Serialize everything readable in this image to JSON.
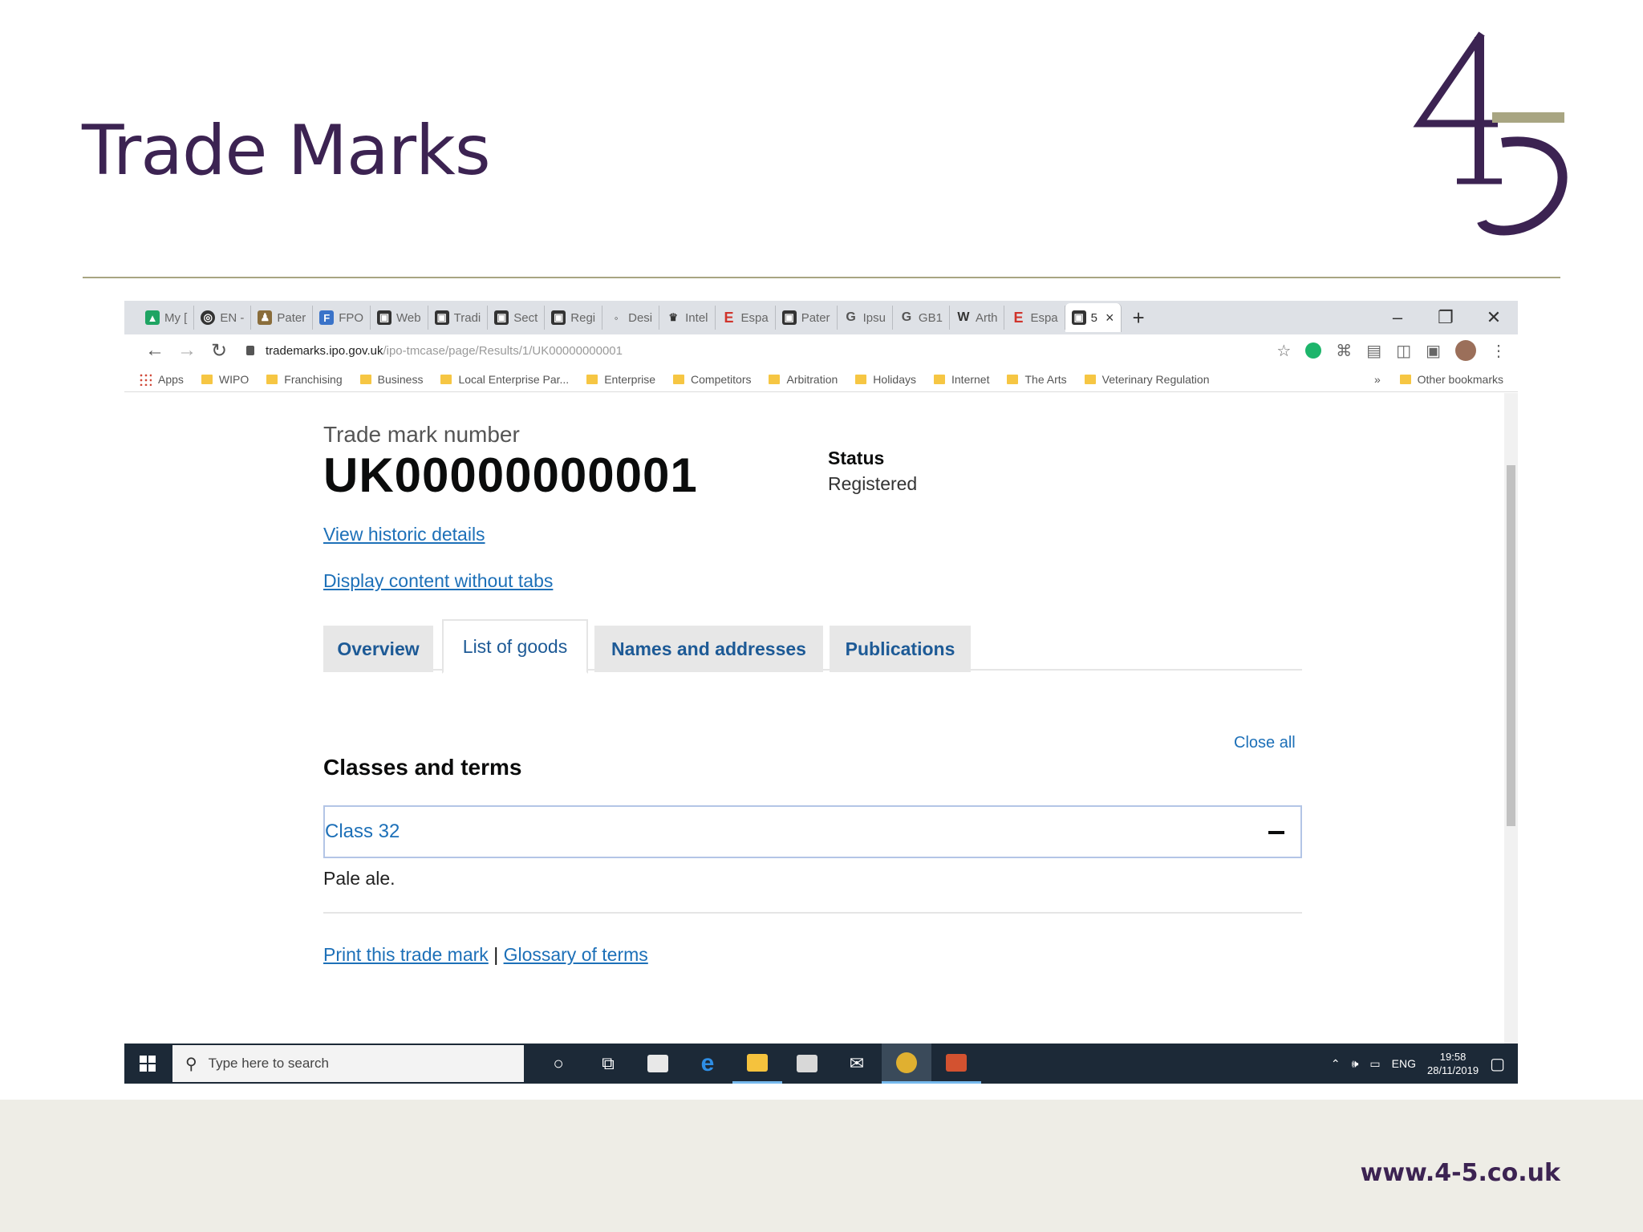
{
  "slide": {
    "title": "Trade Marks",
    "footer_url": "www.4-5.co.uk",
    "logo_text": "45",
    "colors": {
      "title": "#3c2352",
      "accent": "#a8a582",
      "footer_band": "#eeede6"
    }
  },
  "browser": {
    "tabs": [
      {
        "label": "My [",
        "icon": "drive-icon"
      },
      {
        "label": "EN -",
        "icon": "globe-icon"
      },
      {
        "label": "Pater",
        "icon": "people-icon"
      },
      {
        "label": "FPO",
        "icon": "fpo-icon"
      },
      {
        "label": "Web",
        "icon": "page-icon"
      },
      {
        "label": "Tradi",
        "icon": "page-icon"
      },
      {
        "label": "Sect",
        "icon": "page-icon"
      },
      {
        "label": "Regi",
        "icon": "page-icon"
      },
      {
        "label": "Desi",
        "icon": "page-icon"
      },
      {
        "label": "Intel",
        "icon": "crest-icon"
      },
      {
        "label": "Espa",
        "icon": "e-icon"
      },
      {
        "label": "Pater",
        "icon": "page-icon"
      },
      {
        "label": "Ipsu",
        "icon": "google-icon"
      },
      {
        "label": "GB1",
        "icon": "google-icon"
      },
      {
        "label": "Arth",
        "icon": "wikipedia-icon"
      },
      {
        "label": "Espa",
        "icon": "e-icon"
      },
      {
        "label": "5",
        "icon": "page-icon",
        "active": true
      }
    ],
    "url_host": "trademarks.ipo.gov.uk",
    "url_path": "/ipo-tmcase/page/Results/1/UK00000000001",
    "bookmarks": [
      "Apps",
      "WIPO",
      "Franchising",
      "Business",
      "Local Enterprise Par...",
      "Enterprise",
      "Competitors",
      "Arbitration",
      "Holidays",
      "Internet",
      "The Arts",
      "Veterinary Regulation"
    ],
    "other_bookmarks": "Other bookmarks",
    "overflow": "»"
  },
  "page": {
    "tm_label": "Trade mark number",
    "tm_number": "UK00000000001",
    "status_label": "Status",
    "status_value": "Registered",
    "historic_link": "View historic details",
    "no_tabs_link": "Display content without tabs",
    "tabs": [
      "Overview",
      "List of goods",
      "Names and addresses",
      "Publications"
    ],
    "selected_tab": "List of goods",
    "close_all": "Close all",
    "classes_heading": "Classes and terms",
    "class_label": "Class 32",
    "goods_text": "Pale ale.",
    "print_link": "Print this trade mark",
    "separator": "|",
    "glossary_link": "Glossary of terms",
    "link_color": "#1d70b8"
  },
  "taskbar": {
    "search_placeholder": "Type here to search",
    "lang": "ENG",
    "time": "19:58",
    "date": "28/11/2019"
  }
}
